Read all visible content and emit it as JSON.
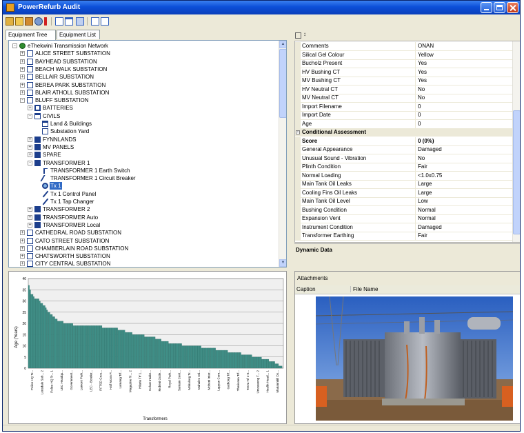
{
  "window": {
    "title": "PowerRefurb Audit"
  },
  "tabs": [
    "Equipment Tree",
    "Equipment List"
  ],
  "tree": [
    {
      "label": "eThekwini Transmission Network",
      "level": 0,
      "icon": "network-icon",
      "exp": "-"
    },
    {
      "label": "ALICE STREET SUBSTATION",
      "level": 1,
      "icon": "substation-icon",
      "exp": "+"
    },
    {
      "label": "BAYHEAD SUBSTATION",
      "level": 1,
      "icon": "substation-icon",
      "exp": "+"
    },
    {
      "label": "BEACH WALK SUBSTATION",
      "level": 1,
      "icon": "substation-icon",
      "exp": "+"
    },
    {
      "label": "BELLAIR SUBSTATION",
      "level": 1,
      "icon": "substation-icon",
      "exp": "+"
    },
    {
      "label": "BEREA PARK SUBSTATION",
      "level": 1,
      "icon": "substation-icon",
      "exp": "+"
    },
    {
      "label": "BLAIR ATHOLL SUBSTATION",
      "level": 1,
      "icon": "substation-icon",
      "exp": "+"
    },
    {
      "label": "BLUFF SUBSTATION",
      "level": 1,
      "icon": "substation-icon",
      "exp": "-"
    },
    {
      "label": "BATTERIES",
      "level": 2,
      "icon": "battery-icon",
      "exp": "+"
    },
    {
      "label": "CIVILS",
      "level": 2,
      "icon": "civils-icon",
      "exp": "-"
    },
    {
      "label": "Land & Buildings",
      "level": 3,
      "icon": "building-icon",
      "exp": ""
    },
    {
      "label": "Substation Yard",
      "level": 3,
      "icon": "yard-icon",
      "exp": ""
    },
    {
      "label": "FYNNLANDS",
      "level": 2,
      "icon": "folder-icon",
      "exp": "+"
    },
    {
      "label": "MV PANELS",
      "level": 2,
      "icon": "folder-icon",
      "exp": "+"
    },
    {
      "label": "SPARE",
      "level": 2,
      "icon": "folder-icon",
      "exp": "+"
    },
    {
      "label": "TRANSFORMER 1",
      "level": 2,
      "icon": "folder-icon",
      "exp": "-"
    },
    {
      "label": "TRANSFORMER 1 Earth Switch",
      "level": 3,
      "icon": "earth-switch-icon",
      "exp": ""
    },
    {
      "label": "TRANSFORMER 1 Circuit Breaker",
      "level": 3,
      "icon": "circuit-breaker-icon",
      "exp": ""
    },
    {
      "label": "Tx 1",
      "level": 3,
      "icon": "transformer-icon",
      "exp": "",
      "selected": true
    },
    {
      "label": "Tx 1 Control Panel",
      "level": 3,
      "icon": "control-panel-icon",
      "exp": ""
    },
    {
      "label": "Tx 1 Tap Changer",
      "level": 3,
      "icon": "tap-changer-icon",
      "exp": ""
    },
    {
      "label": "TRANSFORMER 2",
      "level": 2,
      "icon": "folder-icon",
      "exp": "+"
    },
    {
      "label": "TRANSFORMER Auto",
      "level": 2,
      "icon": "folder-icon",
      "exp": "+"
    },
    {
      "label": "TRANSFORMER Local",
      "level": 2,
      "icon": "folder-icon",
      "exp": "+"
    },
    {
      "label": "CATHEDRAL ROAD SUBSTATION",
      "level": 1,
      "icon": "substation-icon",
      "exp": "+"
    },
    {
      "label": "CATO STREET SUBSTATION",
      "level": 1,
      "icon": "substation-icon",
      "exp": "+"
    },
    {
      "label": "CHAMBERLAIN ROAD SUBSTATION",
      "level": 1,
      "icon": "substation-icon",
      "exp": "+"
    },
    {
      "label": "CHATSWORTH SUBSTATION",
      "level": 1,
      "icon": "substation-icon",
      "exp": "+"
    },
    {
      "label": "CITY CENTRAL SUBSTATION",
      "level": 1,
      "icon": "substation-icon",
      "exp": "+"
    }
  ],
  "properties": {
    "rows": [
      {
        "name": "Comments",
        "value": "ONAN"
      },
      {
        "name": "Silical Gel Colour",
        "value": "Yellow"
      },
      {
        "name": "Bucholz Present",
        "value": "Yes"
      },
      {
        "name": "HV Bushing CT",
        "value": "Yes"
      },
      {
        "name": "MV Bushing CT",
        "value": "Yes"
      },
      {
        "name": "HV Neutral CT",
        "value": "No"
      },
      {
        "name": "MV Neutral CT",
        "value": "No"
      },
      {
        "name": "Import Filename",
        "value": "0"
      },
      {
        "name": "Import Date",
        "value": "0"
      },
      {
        "name": "Age",
        "value": "0"
      },
      {
        "category": "Conditional Assessment"
      },
      {
        "name": "Score",
        "value": "0    (0%)",
        "bold": true
      },
      {
        "name": "General Appearance",
        "value": "Damaged"
      },
      {
        "name": "Unusual Sound - Vibration",
        "value": "No"
      },
      {
        "name": "Plinth Condition",
        "value": "Fair"
      },
      {
        "name": "Normal Loading",
        "value": "<1.0x0.75"
      },
      {
        "name": "Main Tank Oil Leaks",
        "value": "Large"
      },
      {
        "name": "Cooling Fins Oil Leaks",
        "value": "Large"
      },
      {
        "name": "Main Tank Oil Level",
        "value": "Low"
      },
      {
        "name": "Bushing Condition",
        "value": "Normal"
      },
      {
        "name": "Expansion Vent",
        "value": "Normal"
      },
      {
        "name": "Instrument Condition",
        "value": "Damaged"
      },
      {
        "name": "Transformer Earthing",
        "value": "Fair"
      }
    ]
  },
  "dynamic_data": {
    "label": "Dynamic Data"
  },
  "attachments": {
    "label": "Attachments",
    "columns": [
      "Caption",
      "File Name"
    ]
  },
  "chart_data": {
    "type": "bar",
    "xlabel": "Transformers",
    "ylabel": "Age (Years)",
    "ylim": [
      0,
      40
    ],
    "yticks": [
      0,
      5,
      10,
      15,
      20,
      25,
      30,
      35,
      40
    ],
    "categories": [
      "Police HQ Tr...",
      "Lonsdale Sub... 2",
      "Police HQ Tr... 1",
      "LEC Headqu...",
      "Government...",
      "Lamont Park...",
      "LEC - Bonder...",
      "PFTSD Grou...",
      "Half Moon P...",
      "Lamang Trf...",
      "Magazine Tr... 2",
      "Hilaria Trf 1...",
      "Kolvat Intake...",
      "Mobeni Outle...",
      "Royal Park...",
      "Santam Cent...",
      "Mahalong Tr...",
      "Mahaleo Dri...",
      "Mobeni Inter...",
      "Lappan Corn...",
      "Gathong Trf...",
      "Tharisana Trf...",
      "Treva Trf 2 0...",
      "Umzaweng T... 2",
      "Health Head... 1",
      "Mariannhill Do..."
    ],
    "values": [
      37,
      35,
      33,
      33,
      32,
      31,
      31,
      31,
      31,
      30,
      29,
      29,
      28,
      28,
      27,
      26,
      25,
      25,
      24,
      24,
      23,
      23,
      22,
      22,
      21,
      21,
      21,
      21,
      21,
      20,
      20,
      20,
      20,
      20,
      20,
      20,
      20,
      19,
      19,
      19,
      19,
      19,
      19,
      19,
      19,
      19,
      19,
      19,
      19,
      19,
      19,
      19,
      19,
      19,
      19,
      19,
      19,
      19,
      19,
      19,
      19,
      18,
      18,
      18,
      18,
      18,
      18,
      18,
      18,
      18,
      18,
      18,
      18,
      18,
      17,
      17,
      17,
      17,
      17,
      17,
      16,
      16,
      16,
      16,
      16,
      16,
      15,
      15,
      15,
      15,
      15,
      15,
      15,
      15,
      15,
      15,
      14,
      14,
      14,
      14,
      14,
      14,
      14,
      14,
      14,
      13,
      13,
      13,
      13,
      13,
      12,
      12,
      12,
      12,
      12,
      12,
      11,
      11,
      11,
      11,
      11,
      11,
      11,
      11,
      11,
      11,
      11,
      10,
      10,
      10,
      10,
      10,
      10,
      10,
      10,
      10,
      10,
      10,
      10,
      10,
      10,
      10,
      10,
      9,
      9,
      9,
      9,
      9,
      9,
      9,
      9,
      9,
      9,
      9,
      9,
      8,
      8,
      8,
      8,
      8,
      8,
      8,
      8,
      8,
      8,
      7,
      7,
      7,
      7,
      7,
      7,
      7,
      7,
      7,
      7,
      7,
      6,
      6,
      6,
      6,
      6,
      6,
      6,
      6,
      6,
      5,
      5,
      5,
      5,
      5,
      5,
      5,
      5,
      4,
      4,
      4,
      4,
      4,
      4,
      3,
      3,
      3,
      3,
      3,
      2,
      2,
      2,
      1,
      1,
      1,
      0
    ],
    "bar_color": "#3f8f87",
    "grid": true
  }
}
